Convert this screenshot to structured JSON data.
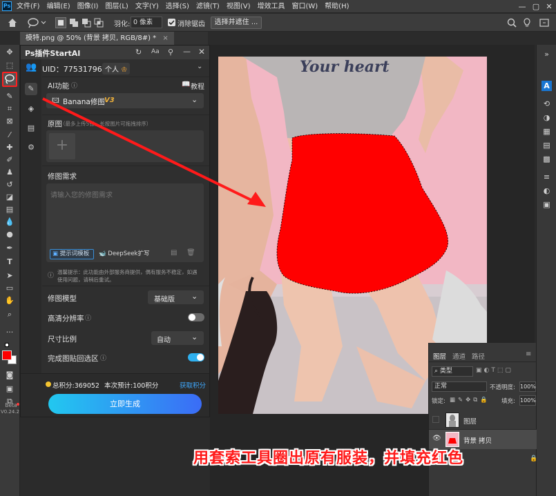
{
  "app": {
    "logo": "Ps",
    "menu": [
      "文件(F)",
      "编辑(E)",
      "图像(I)",
      "图层(L)",
      "文字(Y)",
      "选择(S)",
      "滤镜(T)",
      "视图(V)",
      "增效工具",
      "窗口(W)",
      "帮助(H)"
    ],
    "window_controls": [
      "—",
      "▢",
      "✕"
    ]
  },
  "options_bar": {
    "feather_label": "羽化:",
    "feather_value": "0 像素",
    "antialias_label": "消除锯齿",
    "select_mask_button": "选择并遮住 ..."
  },
  "document_tab": {
    "title": "模特.png @ 50% (背景 拷贝, RGB/8#) *",
    "close": "×"
  },
  "toolbar": {
    "beta_label": "Beta",
    "version": "V0.24.2"
  },
  "plugin": {
    "title": "Ps插件StartAI",
    "uid": "UID：775317965",
    "account_type": "个人",
    "ai_function_label": "AI功能",
    "tutorial_label": "教程",
    "model_selected": "Banana修图",
    "model_version": "V3",
    "original_image_label": "原图",
    "original_image_hint": "（最多上传5张，长按图片可拖拽排序）",
    "add_icon": "+",
    "edit_request_label": "修图需求",
    "edit_request_placeholder": "请输入您的修图需求",
    "prompt_template_button": "提示词模板",
    "deepseek_button": "DeepSeek扩写",
    "notice_text": "温馨提示：此功能由外部服务商提供，偶有服务不稳定，如遇使用问题，请稍后重试。",
    "edit_model_label": "修图模型",
    "edit_model_value": "基础版",
    "hd_label": "高清分辨率",
    "hd_on": false,
    "ratio_label": "尺寸比例",
    "ratio_value": "自动",
    "paste_back_label": "完成图贴回选区",
    "paste_back_on": true,
    "total_points": "总积分:369052",
    "estimate": "本次预计:100积分",
    "get_points": "获取积分",
    "generate_button": "立即生成"
  },
  "photo": {
    "shirt_text": "Your heart"
  },
  "layers_panel": {
    "tabs": [
      "图层",
      "通道",
      "路径"
    ],
    "filter_kind": "类型",
    "blend_mode": "正常",
    "opacity_label": "不透明度:",
    "opacity_value": "100%",
    "lock_label": "锁定:",
    "fill_label": "填充:",
    "fill_value": "100%",
    "layers": [
      {
        "name": "图层",
        "visible": false
      },
      {
        "name": "背景 拷贝",
        "visible": true
      }
    ]
  },
  "caption": "用套索工具圈出原有服装，并填充红色",
  "colors": {
    "foreground": "#ff0000",
    "background": "#ffffff",
    "accent": "#31a8ff",
    "selection_fill": "#ff0000"
  }
}
